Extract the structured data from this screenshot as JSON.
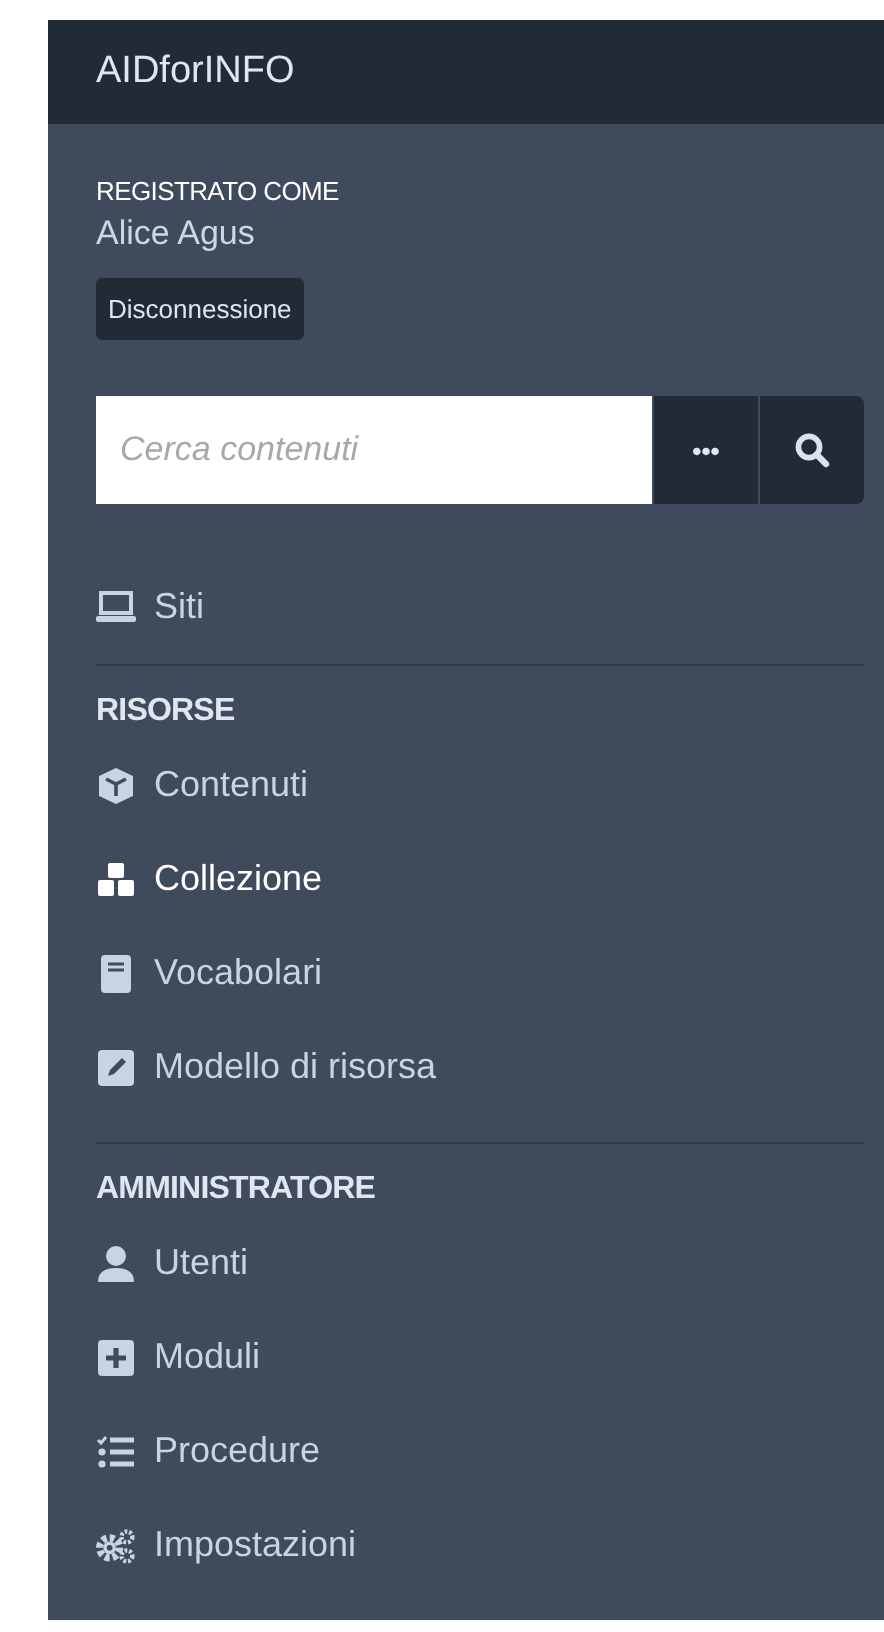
{
  "brand": "AIDforINFO",
  "user": {
    "caption": "REGISTRATO COME",
    "name": "Alice Agus",
    "logout": "Disconnessione"
  },
  "search": {
    "placeholder": "Cerca contenuti",
    "options_button": "•••"
  },
  "nav": [
    {
      "items": [
        {
          "label": "Siti",
          "selected": false
        }
      ]
    },
    {
      "heading": "RISORSE",
      "items": [
        {
          "label": "Contenuti",
          "selected": false
        },
        {
          "label": "Collezione",
          "selected": true
        },
        {
          "label": "Vocabolari",
          "selected": false
        },
        {
          "label": "Modello di risorsa",
          "selected": false
        }
      ]
    },
    {
      "heading": "AMMINISTRATORE",
      "items": [
        {
          "label": "Utenti",
          "selected": false
        },
        {
          "label": "Moduli",
          "selected": false
        },
        {
          "label": "Procedure",
          "selected": false
        },
        {
          "label": "Impostazioni",
          "selected": false
        }
      ]
    }
  ]
}
